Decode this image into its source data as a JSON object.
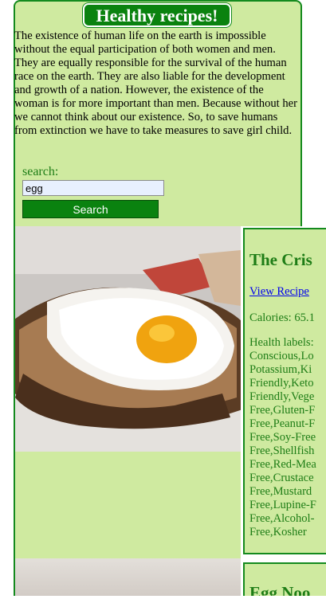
{
  "header": {
    "title": "Healthy recipes!"
  },
  "intro": {
    "text": "The existence of human life on the earth is impossible without the equal participation of both women and men. They are equally responsible for the survival of the human race on the earth. They are also liable for the development and growth of a nation. However, the existence of the woman is for more important than men. Because without her we cannot think about our existence. So, to save humans from extinction we have to take measures to save girl child."
  },
  "search": {
    "label": "search:",
    "value": "egg",
    "button_label": "Search"
  },
  "recipes": [
    {
      "title": "The Cris",
      "link_label": "View Recipe",
      "calories_label": "Calories: 65.1",
      "health_labels_heading": "Health labels:",
      "health_labels_text": "Conscious,Lo Potassium,Ki Friendly,Keto Friendly,Vege Free,Gluten-F Free,Peanut-F Free,Soy-Free Free,Shellfish Free,Red-Mea Free,Crustace Free,Mustard Free,Lupine-F Free,Alcohol- Free,Kosher"
    },
    {
      "title": "Egg Noo"
    }
  ],
  "colors": {
    "accent": "#0a820f",
    "panel": "#cfeaa0",
    "text_green": "#1e7d16",
    "link": "#0000ee"
  },
  "images": [
    "fried-egg-on-toast-photo",
    "egg-noodles-photo"
  ]
}
